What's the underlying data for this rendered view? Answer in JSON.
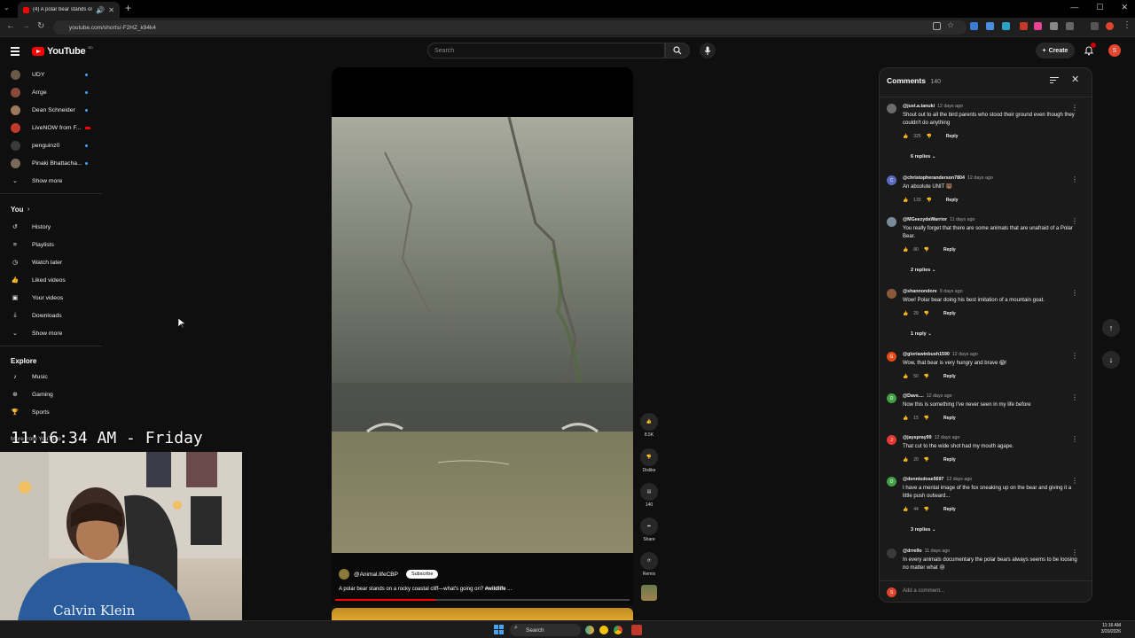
{
  "browser": {
    "tab_title": "(4) A polar bear stands on",
    "url": "youtube.com/shorts/-F2HZ_k94k4",
    "new_tab": "+",
    "win_min": "—",
    "win_max": "☐",
    "win_close": "✕"
  },
  "header": {
    "logo_text": "YouTube",
    "logo_country": "BD",
    "search_placeholder": "Search",
    "create_label": "Create",
    "avatar_letter": "S"
  },
  "sidebar": {
    "subscriptions": [
      {
        "label": "UDY",
        "color": "#6b5a48"
      },
      {
        "label": "Arrge",
        "color": "#8a4a3a"
      },
      {
        "label": "Dean Schneider",
        "color": "#9a7a5a"
      },
      {
        "label": "LiveNOW from F...",
        "color": "#c0392b"
      },
      {
        "label": "penguinz0",
        "color": "#3a3a3a"
      },
      {
        "label": "Pinaki Bhattacha...",
        "color": "#7a6a5a"
      }
    ],
    "show_more_1": "Show more",
    "you_label": "You",
    "you_items": [
      {
        "label": "History",
        "icon": "history-icon"
      },
      {
        "label": "Playlists",
        "icon": "playlists-icon"
      },
      {
        "label": "Watch later",
        "icon": "watch-later-icon"
      },
      {
        "label": "Liked videos",
        "icon": "liked-icon"
      },
      {
        "label": "Your videos",
        "icon": "your-videos-icon"
      },
      {
        "label": "Downloads",
        "icon": "downloads-icon"
      }
    ],
    "show_more_2": "Show more",
    "explore_label": "Explore",
    "explore_items": [
      {
        "label": "Music",
        "icon": "music-icon"
      },
      {
        "label": "Gaming",
        "icon": "gaming-icon"
      },
      {
        "label": "Sports",
        "icon": "sports-icon"
      }
    ],
    "more_from": "More from YouTube"
  },
  "short": {
    "channel": "@Animal.lifeCBP",
    "subscribe": "Subscribe",
    "title": "A polar bear stands on a rocky coastal cliff—what's going on?",
    "hashtag": "#wildlife",
    "ellipsis": "...",
    "progress_fraction": 0.34,
    "actions": {
      "likes": "8.5K",
      "dislike": "Dislike",
      "comments": "140",
      "share": "Share",
      "remix": "Remix"
    }
  },
  "comments": {
    "title": "Comments",
    "count": "140",
    "items": [
      {
        "user": "@just.a.tanuki",
        "time": "12 days ago",
        "text": "Shout out to all the bird parents who stood their ground even though they couldn't do anything",
        "likes": "325",
        "reply": "Reply",
        "avatar_color": "#6b6b6b",
        "avatar": "",
        "replies": "6 replies"
      },
      {
        "user": "@christopheranderson7804",
        "time": "12 days ago",
        "text": "An absolute UNIT 🐻",
        "likes": "133",
        "reply": "Reply",
        "avatar_color": "#5c6bc0",
        "avatar": "C",
        "replies": ""
      },
      {
        "user": "@MGeezydaWarrior",
        "time": "11 days ago",
        "text": "You really forget that there are some animals that are unafraid of a Polar Bear.",
        "likes": "80",
        "reply": "Reply",
        "avatar_color": "#7a8a9a",
        "avatar": "",
        "replies": "2 replies"
      },
      {
        "user": "@shannondore",
        "time": "9 days ago",
        "text": "Wow! Polar bear doing his best imitation of a mountain goat.",
        "likes": "29",
        "reply": "Reply",
        "avatar_color": "#8a5a3a",
        "avatar": "",
        "replies": "1 reply"
      },
      {
        "user": "@gloriawinbush1590",
        "time": "12 days ago",
        "text": "Wow, that bear is very hungry and brave 😱!",
        "likes": "50",
        "reply": "Reply",
        "avatar_color": "#e64a19",
        "avatar": "G",
        "replies": ""
      },
      {
        "user": "@Dave....",
        "time": "12 days ago",
        "text": "Now this is something I've never seen in my life before",
        "likes": "15",
        "reply": "Reply",
        "avatar_color": "#43a047",
        "avatar": "D",
        "replies": ""
      },
      {
        "user": "@jayspray99",
        "time": "12 days ago",
        "text": "That cut to the wide shot had my mouth agape.",
        "likes": "20",
        "reply": "Reply",
        "avatar_color": "#e53935",
        "avatar": "J",
        "replies": ""
      },
      {
        "user": "@dennisdose5697",
        "time": "12 days ago",
        "text": "I have a mental image of the fox sneaking up on the bear and giving it a little push outward...",
        "likes": "44",
        "reply": "Reply",
        "avatar_color": "#43a047",
        "avatar": "D",
        "replies": "3 replies"
      },
      {
        "user": "@drrello",
        "time": "11 days ago",
        "text": "In every animals documentary the polar bears always seems to be loosing no matter what 😢",
        "likes": "",
        "reply": "",
        "avatar_color": "#3a3a3a",
        "avatar": "",
        "replies": ""
      }
    ],
    "add_placeholder": "Add a comment..."
  },
  "overlay": {
    "clock": "11:16:34 AM - Friday",
    "webcam_shirt_text": "Calvin Klein"
  },
  "taskbar": {
    "search": "Search",
    "time": "11:16 AM",
    "date": "3/20/2026"
  },
  "colors": {
    "accent_red": "#ff0000",
    "link_blue": "#3ea6ff",
    "bg": "#0f0f0f"
  }
}
